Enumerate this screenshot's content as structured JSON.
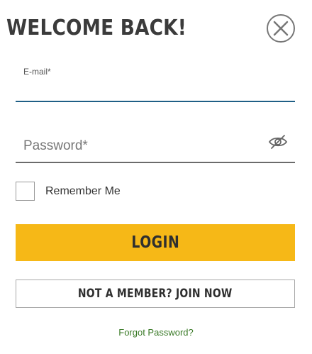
{
  "header": {
    "title": "WELCOME BACK!"
  },
  "form": {
    "email": {
      "label": "E-mail*",
      "value": ""
    },
    "password": {
      "placeholder": "Password*",
      "value": ""
    },
    "remember": {
      "label": "Remember Me",
      "checked": false
    },
    "login_label": "LOGIN",
    "join_label": "NOT A MEMBER? JOIN NOW",
    "forgot_label": "Forgot Password?"
  },
  "icons": {
    "close": "close-icon",
    "password_visibility": "eye-slash-icon"
  },
  "colors": {
    "accent": "#f6b817",
    "link": "#3a7a27",
    "email_underline": "#1f5f86"
  }
}
